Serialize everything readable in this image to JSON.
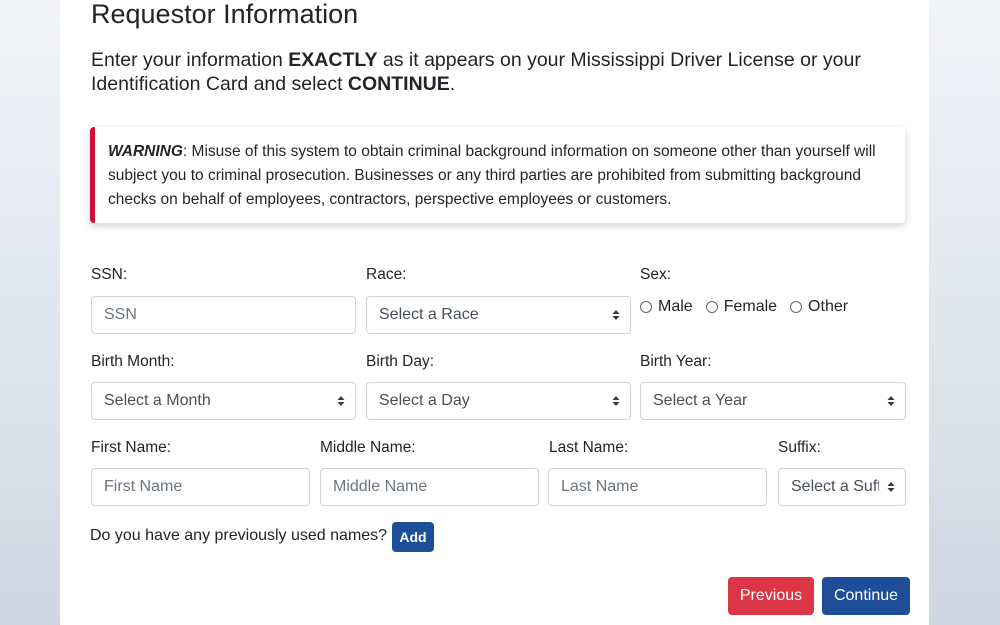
{
  "page": {
    "title": "Requestor Information",
    "intro": {
      "part1": "Enter your information ",
      "bold1": "EXACTLY",
      "part2": " as it appears on your Mississippi Driver License or your Identification Card and select ",
      "bold2": "CONTINUE",
      "part3": "."
    }
  },
  "warning": {
    "label": "WARNING",
    "text": ": Misuse of this system to obtain criminal background information on someone other than yourself will subject you to criminal prosecution. Businesses or any third parties are prohibited from submitting background checks on behalf of employees, contractors, perspective employees or customers.",
    "accent_color": "#d0103a"
  },
  "form": {
    "ssn": {
      "label": "SSN:",
      "placeholder": "SSN",
      "value": ""
    },
    "race": {
      "label": "Race:",
      "selected": "Select a Race"
    },
    "sex": {
      "label": "Sex:",
      "options": [
        "Male",
        "Female",
        "Other"
      ],
      "selected": null
    },
    "birth_month": {
      "label": "Birth Month:",
      "selected": "Select a Month"
    },
    "birth_day": {
      "label": "Birth Day:",
      "selected": "Select a Day"
    },
    "birth_year": {
      "label": "Birth Year:",
      "selected": "Select a Year"
    },
    "first_name": {
      "label": "First Name:",
      "placeholder": "First Name",
      "value": ""
    },
    "middle_name": {
      "label": "Middle Name:",
      "placeholder": "Middle Name",
      "value": ""
    },
    "last_name": {
      "label": "Last Name:",
      "placeholder": "Last Name",
      "value": ""
    },
    "suffix": {
      "label": "Suffix:",
      "selected": "Select a Suffix"
    },
    "previous_names": {
      "question": "Do you have any previously used names?",
      "add_label": "Add"
    }
  },
  "actions": {
    "previous_label": "Previous",
    "continue_label": "Continue",
    "previous_color": "#dc3545",
    "continue_color": "#1f4e99"
  }
}
